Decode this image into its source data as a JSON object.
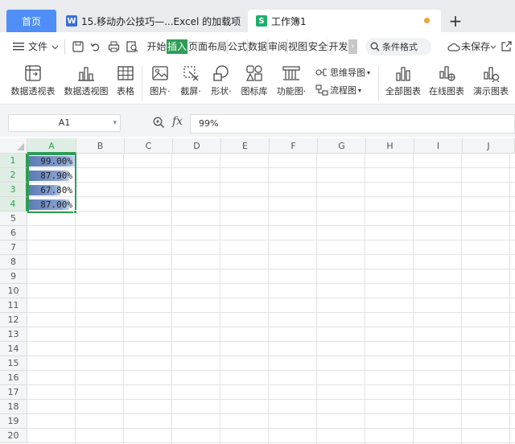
{
  "tabs": {
    "home": "首页",
    "doc": "15.移动办公技巧—...Excel 的加载项",
    "workbook": "工作簿1",
    "doc_icon": "W",
    "workbook_icon": "S"
  },
  "menu": {
    "file": "文件",
    "ribbon_tabs": [
      "开始",
      "插入",
      "页面布局",
      "公式",
      "数据",
      "审阅",
      "视图",
      "安全",
      "开发"
    ],
    "active_tab": "插入",
    "search": "条件格式",
    "unsaved": "未保存"
  },
  "ribbon": {
    "pivot_table": "数据透视表",
    "pivot_chart": "数据透视图",
    "table": "表格",
    "picture": "图片",
    "screenshot": "截屏",
    "shape": "形状",
    "icon_lib": "图标库",
    "function_chart": "功能图",
    "mind_map": "思维导图",
    "flow_chart": "流程图",
    "all_charts": "全部图表",
    "online_charts": "在线图表",
    "demo_charts": "演示图表"
  },
  "formula_bar": {
    "name_box": "A1",
    "fx": "fx",
    "value": "99%"
  },
  "grid": {
    "columns": [
      "A",
      "B",
      "C",
      "D",
      "E",
      "F",
      "G",
      "H",
      "I",
      "J"
    ],
    "rows": [
      "1",
      "2",
      "3",
      "4",
      "5",
      "6",
      "7",
      "8",
      "9",
      "10",
      "11",
      "12",
      "13",
      "14",
      "15",
      "16",
      "17",
      "18",
      "19",
      "20"
    ],
    "cells": [
      {
        "display": "99.00%",
        "value": 0.99
      },
      {
        "display": "87.90%",
        "value": 0.879
      },
      {
        "display": "67.80%",
        "value": 0.678
      },
      {
        "display": "87.00%",
        "value": 0.87
      }
    ]
  },
  "colors": {
    "accent": "#2e9d55",
    "home_tab": "#4f8ef7",
    "databar": "#5b7bb5"
  }
}
